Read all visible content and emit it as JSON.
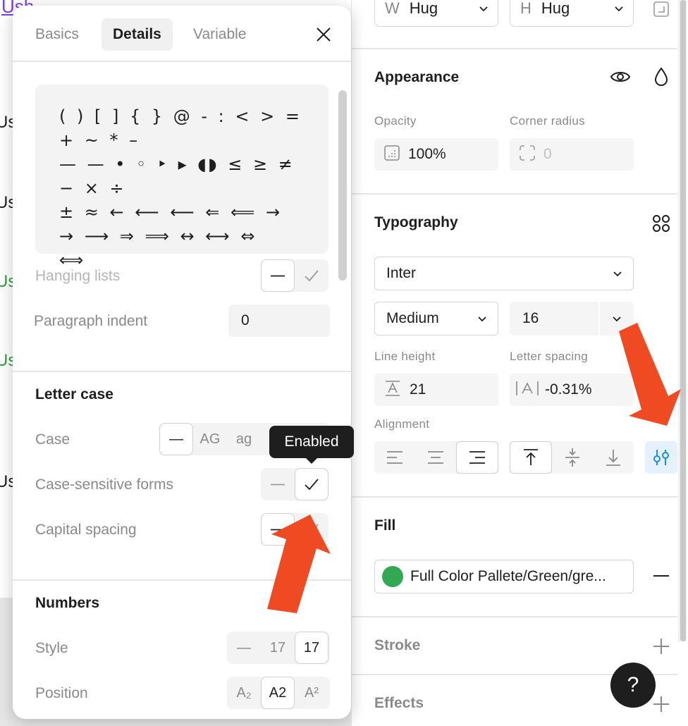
{
  "canvas": {
    "top_link": "Ush",
    "labels": [
      {
        "text": "Us",
        "color": "dark"
      },
      {
        "text": "Us",
        "color": "dark"
      },
      {
        "text": "Us",
        "color": "green"
      },
      {
        "text": "Us",
        "color": "green"
      },
      {
        "text": "Us",
        "color": "dark"
      }
    ]
  },
  "right_panel": {
    "width_prefix": "W",
    "width_value": "Hug",
    "height_prefix": "H",
    "height_value": "Hug",
    "appearance": {
      "title": "Appearance",
      "opacity_label": "Opacity",
      "opacity_value": "100%",
      "corner_label": "Corner radius",
      "corner_value": "0"
    },
    "typography": {
      "title": "Typography",
      "font_family": "Inter",
      "font_weight": "Medium",
      "font_size": "16",
      "line_height_label": "Line height",
      "line_height_value": "21",
      "letter_spacing_label": "Letter spacing",
      "letter_spacing_value": "-0.31%",
      "alignment_label": "Alignment",
      "align_selected": "right",
      "vertical_selected": "top"
    },
    "fill": {
      "title": "Fill",
      "name": "Full Color Pallete/Green/gre...",
      "swatch_color": "#33a852"
    },
    "stroke": {
      "title": "Stroke"
    },
    "effects": {
      "title": "Effects"
    },
    "help": "?"
  },
  "popup": {
    "tabs": [
      {
        "label": "Basics",
        "active": false
      },
      {
        "label": "Details",
        "active": true
      },
      {
        "label": "Variable",
        "active": false
      }
    ],
    "preview_lines": [
      "( ) [ ] { } @ - : < > = + ~ * –",
      "— — • ◦ ‣ ▸ ◖◗ ≤ ≥ ≠ − × ÷",
      "± ≈ ← ⟵ ⟵ ⇐ ⟸ →",
      "→ ⟶ ⇒ ⟹ ↔ ⟷ ⇔",
      "⟺"
    ],
    "hanging_lists_label": "Hanging lists",
    "paragraph_indent_label": "Paragraph indent",
    "paragraph_indent_value": "0",
    "letter_case": {
      "title": "Letter case",
      "case_label": "Case",
      "case_options": [
        "—",
        "AG",
        "ag"
      ],
      "case_sensitive_label": "Case-sensitive forms",
      "capital_spacing_label": "Capital spacing"
    },
    "tooltip": "Enabled",
    "numbers": {
      "title": "Numbers",
      "style_label": "Style",
      "style_options": [
        "—",
        "17",
        "17"
      ],
      "position_label": "Position",
      "position_options": [
        "A₂",
        "A2",
        "A²"
      ]
    }
  },
  "colors": {
    "annotation_arrow": "#f04a23",
    "selected_blue": "#e5f1fc",
    "selected_blue_icon": "#1a8cf0"
  }
}
